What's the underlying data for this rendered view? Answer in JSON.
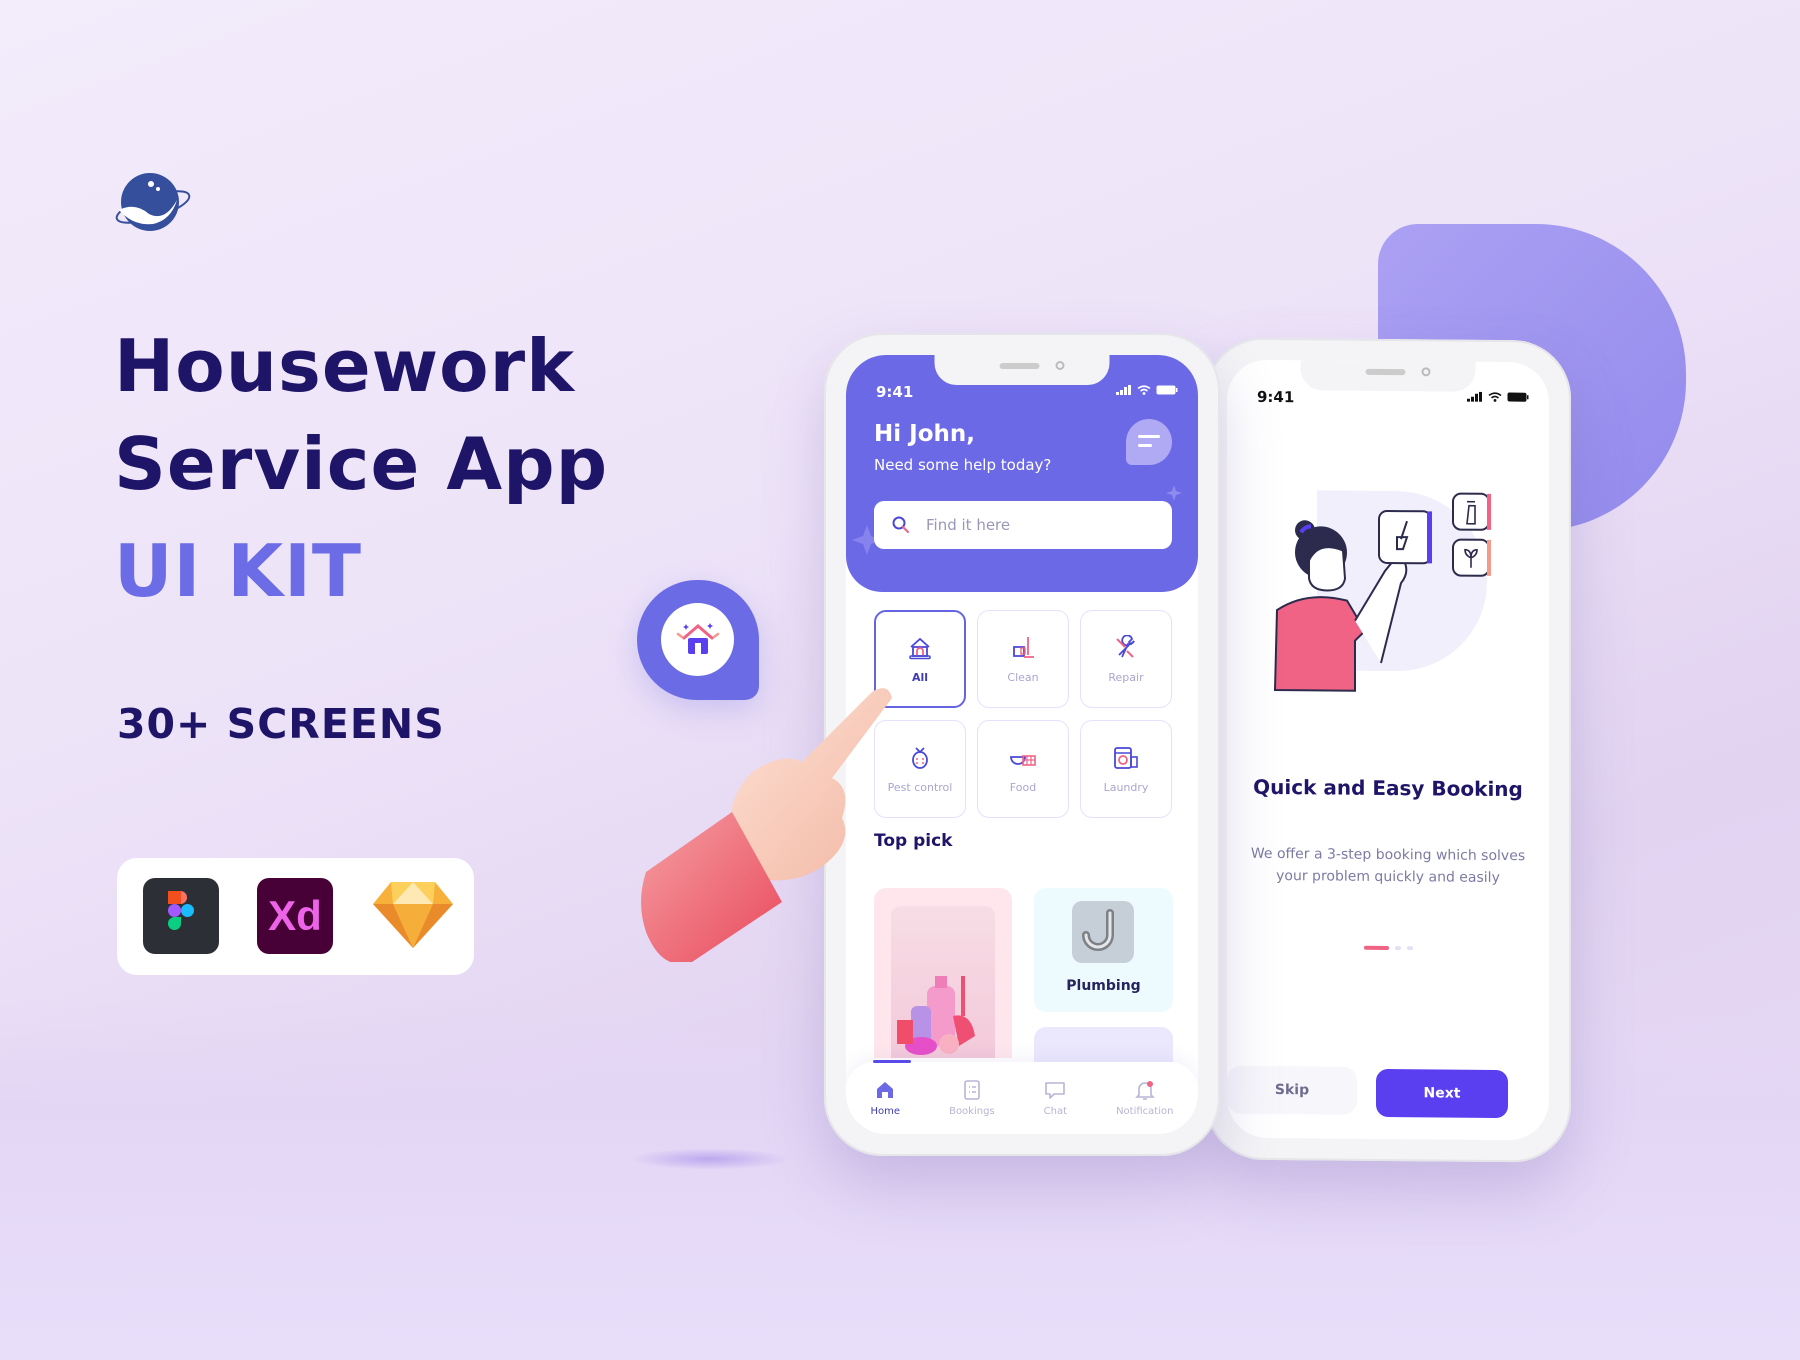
{
  "brand": {
    "logo": "planet-logo-icon"
  },
  "hero": {
    "title_line1": "Housework",
    "title_line2": "Service App",
    "title_line3": "UI KIT",
    "screens_count": "30+ SCREENS",
    "tools": [
      {
        "name": "Figma",
        "icon": "figma-icon"
      },
      {
        "name": "Xd",
        "icon": "adobe-xd-icon"
      },
      {
        "name": "Sketch",
        "icon": "sketch-icon"
      }
    ]
  },
  "colors": {
    "primary": "#6b69e6",
    "dark_text": "#1f1568",
    "accent_pink": "#f06385",
    "button": "#5a3ff0"
  },
  "home_screen": {
    "status_time": "9:41",
    "greeting": "Hi John,",
    "subtitle": "Need some help today?",
    "search_placeholder": "Find it here",
    "categories": [
      {
        "label": "All",
        "icon": "house-icon",
        "active": true
      },
      {
        "label": "Clean",
        "icon": "bucket-mop-icon",
        "active": false
      },
      {
        "label": "Repair",
        "icon": "wrench-icon",
        "active": false
      },
      {
        "label": "Pest control",
        "icon": "ladybug-icon",
        "active": false
      },
      {
        "label": "Food",
        "icon": "food-basket-icon",
        "active": false
      },
      {
        "label": "Laundry",
        "icon": "washing-machine-icon",
        "active": false
      }
    ],
    "top_pick_title": "Top pick",
    "top_picks": [
      {
        "label": "",
        "image": "cleaning-products-image"
      },
      {
        "label": "Plumbing",
        "image": "pipe-image"
      }
    ],
    "tabs": [
      {
        "label": "Home",
        "icon": "home-icon",
        "active": true
      },
      {
        "label": "Bookings",
        "icon": "list-icon",
        "active": false
      },
      {
        "label": "Chat",
        "icon": "chat-icon",
        "active": false
      },
      {
        "label": "Notification",
        "icon": "bell-icon",
        "active": false
      }
    ]
  },
  "onboarding_screen": {
    "status_time": "9:41",
    "title": "Quick and Easy Booking",
    "description": "We offer a 3-step booking which solves your problem quickly and easily",
    "page_index": 1,
    "page_count": 3,
    "skip_label": "Skip",
    "next_label": "Next"
  }
}
